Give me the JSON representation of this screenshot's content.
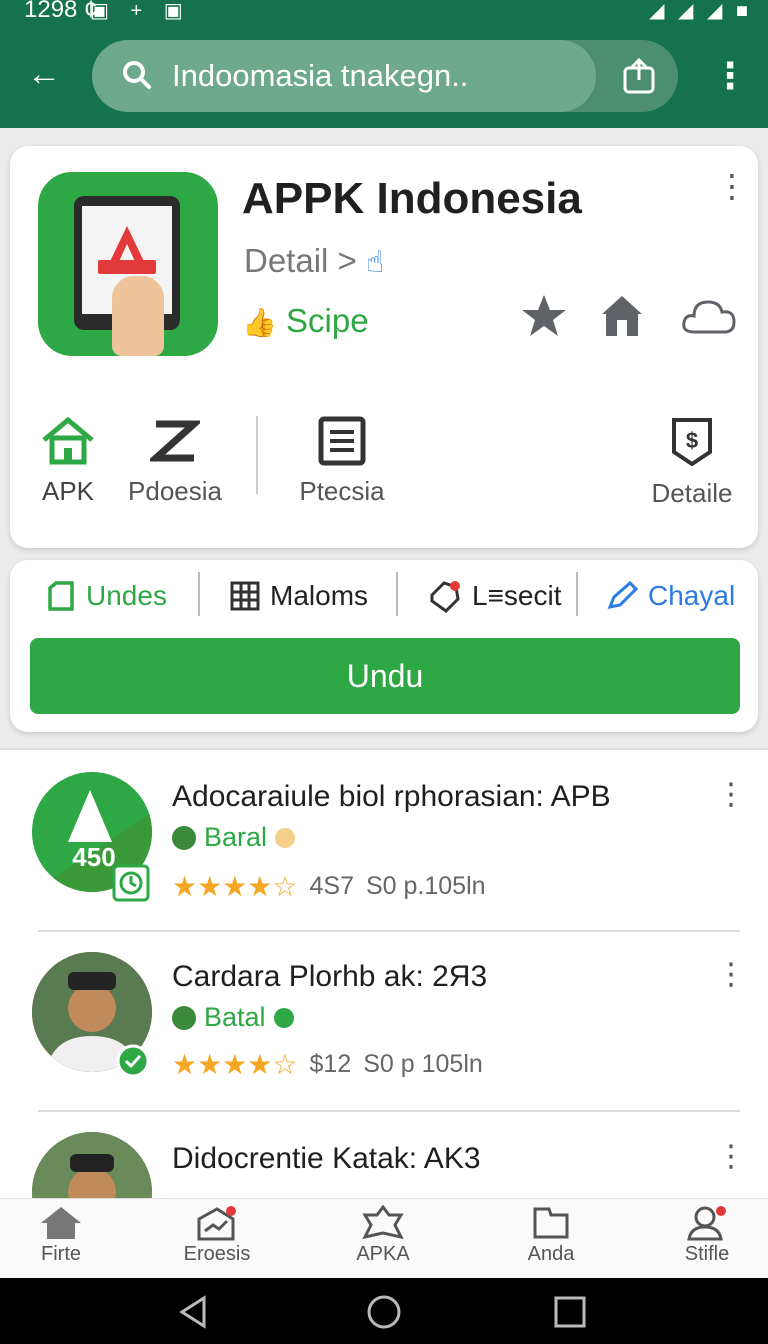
{
  "status_bar": {
    "time": "1298 ¢",
    "icons": "▣ + ▣",
    "signal": "◢ ◢ ◢ ■"
  },
  "search": {
    "text": "Indoomasia tnakegn.."
  },
  "app": {
    "title": "APPK Indonesia",
    "detail": "Detail >",
    "rating_label": "Scipe",
    "categories": [
      "APK",
      "Pdoesia",
      "Ptecsia",
      "Detaile"
    ]
  },
  "tabs": [
    "Undes",
    "Maloms",
    "L≡secit",
    "Chayal"
  ],
  "primary_button": "Undu",
  "list": [
    {
      "title": "Adocaraiule biol rphorasian: APB",
      "author": "Baral",
      "rating": "4S7",
      "meta": "S0 p.105ln",
      "badge": "450"
    },
    {
      "title": "Cardara Plorhb ak: 2Я3",
      "author": "Batal",
      "rating": "$12",
      "meta": "S0 p 105ln"
    },
    {
      "title": "Didocrentie Katak: AK3",
      "author": "",
      "rating": "",
      "meta": ""
    }
  ],
  "bottom_nav": [
    "Firte",
    "Eroesis",
    "APKA",
    "Anda",
    "Stifle"
  ],
  "colors": {
    "primary_green": "#2ea844",
    "app_bar": "#14734e",
    "accent_blue": "#2a7be4",
    "star": "#f5a623"
  }
}
